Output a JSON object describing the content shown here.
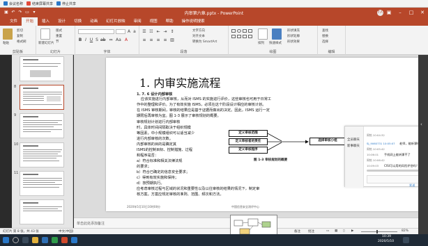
{
  "sharebar": {
    "items": [
      "会议名称",
      "结束屏幕共享",
      "停止共享"
    ]
  },
  "window": {
    "title": "内审第六章.pptx - PowerPoint",
    "user_badge": "7人"
  },
  "tabs": [
    "文件",
    "开始",
    "插入",
    "设计",
    "切换",
    "动画",
    "幻灯片放映",
    "审阅",
    "视图",
    "帮助",
    "操作说明搜索"
  ],
  "ribbon": {
    "clipboard": {
      "paste": "粘贴",
      "cut": "剪切",
      "copy": "复制",
      "format": "格式刷",
      "label": "剪贴板"
    },
    "slides": {
      "new": "新建幻灯片",
      "layout": "版式",
      "reset": "重置",
      "section": "节",
      "label": "幻灯片"
    },
    "font": {
      "label": "字体"
    },
    "paragraph": {
      "text_dir": "文字方向",
      "align": "对齐文本",
      "smartart": "转换为 SmartArt",
      "label": "段落"
    },
    "drawing": {
      "arrange": "排列",
      "quick_styles": "快速样式",
      "fill": "形状填充",
      "outline": "形状轮廓",
      "effects": "形状效果",
      "label": "绘图"
    },
    "editing": {
      "find": "查找",
      "replace": "替换",
      "select": "选择",
      "label": "编辑"
    }
  },
  "thumbnails": {
    "numbers": [
      "",
      "8",
      "9",
      "10",
      "11"
    ],
    "selected_index": 1
  },
  "slide": {
    "title": "1. 内审实施流程",
    "section": "1. 7. 6    设计内部审核",
    "paragraphs": [
      "应该实施进行内部审核，从而对 ISMS 的实施进行评价，这些审核也可用于日常工",
      "作中的整理和评价。为了有效实施 ISMS，必须在这个阶段设计相应的审核计划。",
      "    在 ISMS 审核期间，审核的结果应是基于证据而做出的决定。因此，ISMS 运行一定",
      "期限后再审核为宜。图 1-3 展示了审核规划的概要。",
      "    审核规划计划进行内部审核",
      "时，具体时间间隔取决于组织规模",
      "等因素。中小规模组织可以适当减少",
      "进行内部审核的次数。",
      "    内部审核的目的是确定其",
      "ISMS的控制目标、控制措施、过程",
      "和程序是否：",
      "    a）符合标准和相关法律法规",
      "的要求；",
      "    b）符合已确定的信息安全要求；",
      "    c）得到有效实施和保持；",
      "    d）按预期执行。",
      "    应考虑审核过程与区域的状况和重要性以及以往审核的结果的情况下，制定审",
      "核方案。方案应规定审核的准则、范围、频次和方法。"
    ],
    "diagram": {
      "boxes": [
        "定义审核范围",
        "定义审核者的责任",
        "定义审核程序"
      ],
      "target": "选择审核小组",
      "caption": "图 1-3    审核规划的概要"
    },
    "footer_left": "2020年5月10日10时08分",
    "footer_center": "中国信息安全测评中心"
  },
  "chat": {
    "side_labels": [
      "全员聊天",
      "新事聊天"
    ],
    "messages": [
      {
        "meta": "周铭 10:04:32",
        "text": ""
      },
      {
        "meta": "SJ_9060731 10:05:07",
        "text": "老师，能听课吗"
      },
      {
        "meta": "周铭 10:05:42",
        "text": ""
      },
      {
        "meta": "10:06:01",
        "text": "手机网上能听课不了"
      },
      {
        "meta": "周铭 10:06:42",
        "text": ""
      },
      {
        "meta": "10:09:03",
        "text": "CISI可以用的风险评估吗？"
      }
    ],
    "send": "发送"
  },
  "notes": {
    "placeholder": "单击此处添加备注"
  },
  "status": {
    "slide_info": "幻灯片 第 8 张，共 43 张",
    "lang": "中文(中国)",
    "notes_btn": "备注",
    "comments_btn": "批注",
    "zoom": "82%"
  },
  "video": {
    "timer": "02:05:04"
  },
  "taskbar": {
    "time": "10:39",
    "date": "2020/5/10"
  },
  "colors": {
    "accent": "#b7472a",
    "ribbon_bg": "#f3f3f3",
    "taskbar": "#1f2a36"
  }
}
